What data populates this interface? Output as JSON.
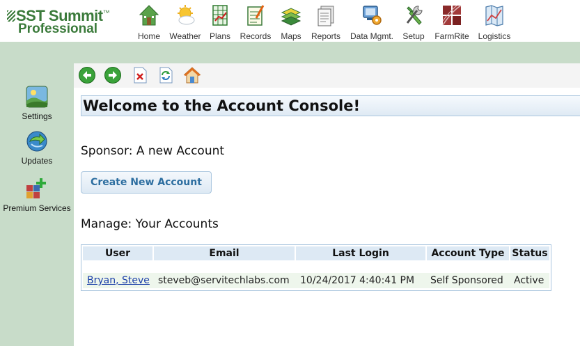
{
  "app": {
    "logo_line1": "SST Summit",
    "logo_tm": "™",
    "logo_line2": "Professional"
  },
  "nav": [
    {
      "label": "Home",
      "icon": "home-icon"
    },
    {
      "label": "Weather",
      "icon": "weather-icon"
    },
    {
      "label": "Plans",
      "icon": "plans-icon"
    },
    {
      "label": "Records",
      "icon": "records-icon"
    },
    {
      "label": "Maps",
      "icon": "maps-icon"
    },
    {
      "label": "Reports",
      "icon": "reports-icon"
    },
    {
      "label": "Data Mgmt.",
      "icon": "data-management-icon"
    },
    {
      "label": "Setup",
      "icon": "setup-icon"
    },
    {
      "label": "FarmRite",
      "icon": "farmrite-icon"
    },
    {
      "label": "Logistics",
      "icon": "logistics-icon"
    }
  ],
  "sidebar": [
    {
      "label": "Settings",
      "icon": "settings-icon"
    },
    {
      "label": "Updates",
      "icon": "updates-icon"
    },
    {
      "label": "Premium Services",
      "icon": "premium-services-icon"
    }
  ],
  "toolbar": {
    "icons": [
      "back-arrow-icon",
      "forward-arrow-icon",
      "close-page-icon",
      "refresh-icon",
      "home-page-icon"
    ]
  },
  "main": {
    "title": "Welcome to the Account Console!",
    "sponsor_heading": "Sponsor: A new Account",
    "create_button": "Create New Account",
    "manage_heading": "Manage: Your Accounts"
  },
  "accounts_table": {
    "columns": [
      "User",
      "Email",
      "Last Login",
      "Account Type",
      "Status"
    ],
    "rows": [
      {
        "user": "Bryan, Steve",
        "email": "steveb@servitechlabs.com",
        "last_login": "10/24/2017 4:40:41 PM",
        "account_type": "Self Sponsored",
        "status": "Active"
      }
    ]
  },
  "colors": {
    "sidebar_bg": "#c8dcc9",
    "header_bg": "#dde9f4",
    "border": "#a9c5de",
    "row_bg": "#eef6ec",
    "logo_green": "#3a7a3a",
    "button_text": "#2d6ea0"
  }
}
